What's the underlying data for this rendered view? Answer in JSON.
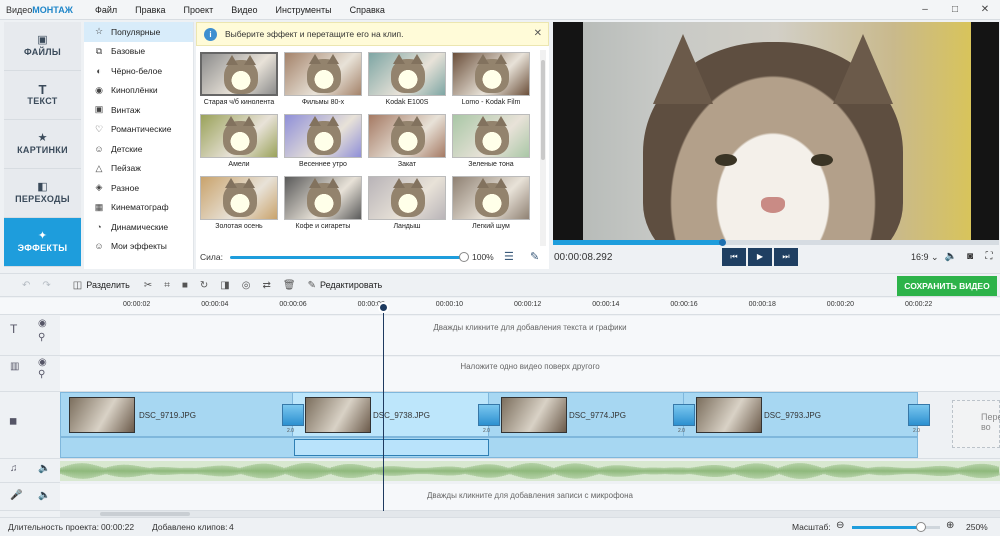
{
  "app": {
    "name_prefix": "Видео",
    "name_brand": "МОНТАЖ"
  },
  "menu": [
    "Файл",
    "Правка",
    "Проект",
    "Видео",
    "Инструменты",
    "Справка"
  ],
  "window_controls": [
    "–",
    "□",
    "✕"
  ],
  "categories": [
    {
      "label": "ФАЙЛЫ",
      "icon": "image-icon"
    },
    {
      "label": "ТЕКСТ",
      "icon": "text-icon"
    },
    {
      "label": "КАРТИНКИ",
      "icon": "star-icon"
    },
    {
      "label": "ПЕРЕХОДЫ",
      "icon": "transitions-icon"
    },
    {
      "label": "ЭФФЕКТЫ",
      "icon": "effects-icon",
      "active": true
    }
  ],
  "effect_groups": [
    {
      "label": "Популярные",
      "icon": "☆",
      "active": true
    },
    {
      "label": "Базовые",
      "icon": "⧉"
    },
    {
      "label": "Чёрно-белое",
      "icon": "◐"
    },
    {
      "label": "Киноплёнки",
      "icon": "◉"
    },
    {
      "label": "Винтаж",
      "icon": "▣"
    },
    {
      "label": "Романтические",
      "icon": "♡"
    },
    {
      "label": "Детские",
      "icon": "☺"
    },
    {
      "label": "Пейзаж",
      "icon": "△"
    },
    {
      "label": "Разное",
      "icon": "◈"
    },
    {
      "label": "Кинематограф",
      "icon": "▦"
    },
    {
      "label": "Динамические",
      "icon": "◔"
    },
    {
      "label": "Мои эффекты",
      "icon": "☺"
    }
  ],
  "info": {
    "text": "Выберите эффект и перетащите его на клип."
  },
  "effects": [
    {
      "label": "Старая ч/б кинолента",
      "tint": "#8c8c8c",
      "selected": true
    },
    {
      "label": "Фильмы 80-х",
      "tint": "#a4836a"
    },
    {
      "label": "Kodak E100S",
      "tint": "#7ea6a4"
    },
    {
      "label": "Lomo - Kodak Film",
      "tint": "#6b4f3a"
    },
    {
      "label": "Амели",
      "tint": "#9aa25a"
    },
    {
      "label": "Весеннее утро",
      "tint": "#8f8fd8"
    },
    {
      "label": "Закат",
      "tint": "#a57a64"
    },
    {
      "label": "Зеленые тона",
      "tint": "#a9c7a6"
    },
    {
      "label": "Золотая осень",
      "tint": "#c9a36c"
    },
    {
      "label": "Кофе и сигареты",
      "tint": "#5a5a5a"
    },
    {
      "label": "Ландыш",
      "tint": "#b9b4b8"
    },
    {
      "label": "Легкий шум",
      "tint": "#8f8173"
    }
  ],
  "strength": {
    "label": "Сила:",
    "value": "100%",
    "fraction": 1.0
  },
  "preview": {
    "timecode": "00:00:08.292",
    "aspect": "16:9",
    "progress_fraction": 0.38
  },
  "toolbar": {
    "split": "Разделить",
    "edit": "Редактировать",
    "save": "СОХРАНИТЬ ВИДЕО"
  },
  "ruler_ticks": [
    "00:00:02",
    "00:00:04",
    "00:00:06",
    "00:00:08",
    "00:00:10",
    "00:00:12",
    "00:00:14",
    "00:00:16",
    "00:00:18",
    "00:00:20",
    "00:00:22"
  ],
  "tracks": {
    "text_hint": "Дважды кликните для добавления текста и графики",
    "overlay_hint": "Наложите одно видео поверх другого",
    "mic_hint": "Дважды кликните для добавления записи с микрофона"
  },
  "clips": [
    {
      "name": "DSC_9719.JPG"
    },
    {
      "name": "DSC_9738.JPG",
      "selected": true
    },
    {
      "name": "DSC_9774.JPG"
    },
    {
      "name": "DSC_9793.JPG"
    }
  ],
  "transition_duration": "2.0",
  "next_clip_label": "Пере\nво",
  "status": {
    "duration_label": "Длительность проекта:",
    "duration": "00:00:22",
    "added_label": "Добавлено клипов:",
    "added": "4",
    "zoom_label": "Масштаб:",
    "zoom": "250%",
    "zoom_fraction": 0.78
  }
}
